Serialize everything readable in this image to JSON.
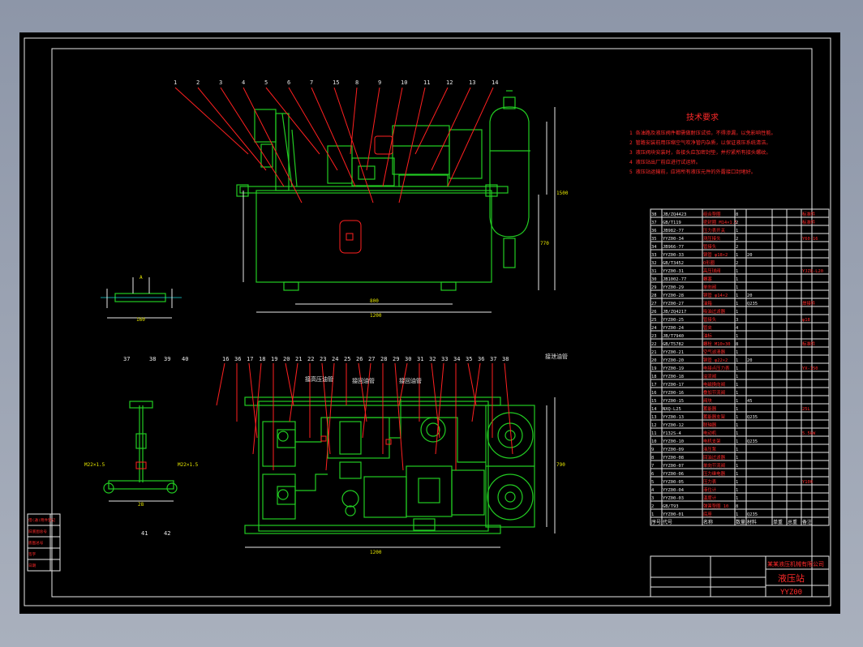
{
  "tech_requirements": {
    "title": "技术要求",
    "items": [
      "1 各油路及液压阀件都需做耐压试验，不得渗漏，以免影响性能。",
      "2 管路安装前用压缩空气吹净管内杂质，以保证液压系统清洁。",
      "3 液压阀块安装时，各接头应加密封垫，并拧紧所有接头螺纹。",
      "4 液压站出厂前应进行试运转。",
      "5 液压站运输前，应将所有液压元件的外露接口封堵好。"
    ]
  },
  "title_block": {
    "company": "某某液压机械有限公司",
    "drawing_name": "液压站",
    "drawing_code": "YYZ00"
  },
  "left_revision_block": {
    "rows": [
      "借(通)用件登记",
      "旧底图总号",
      "底图总号",
      "签字",
      "日期"
    ]
  },
  "top_view_callouts": [
    "1",
    "2",
    "3",
    "4",
    "5",
    "6",
    "7",
    "15",
    "8",
    "9",
    "10",
    "11",
    "12",
    "13",
    "14"
  ],
  "bottom_view_callouts": [
    "16",
    "36",
    "17",
    "18",
    "19",
    "20",
    "21",
    "22",
    "23",
    "24",
    "25",
    "26",
    "27",
    "28",
    "29",
    "30",
    "31",
    "32",
    "33",
    "34",
    "35",
    "36",
    "37",
    "38"
  ],
  "side_detail_callouts": [
    "37",
    "38",
    "39",
    "40",
    "41",
    "42"
  ],
  "dimensions": {
    "top_width": "1200",
    "top_base": "800",
    "top_height": "1500",
    "tank_height": "770",
    "bottom_width": "1200",
    "bottom_depth": "790",
    "detail_width": "160",
    "side_width": "28",
    "fitting_a": "M22×1.5",
    "fitting_b": "M22×1.5"
  },
  "flow_labels": [
    "接高压油管",
    "接回油管",
    "接回油管",
    "接泄油管"
  ],
  "bom_header": [
    "序号",
    "代号",
    "名称",
    "数量",
    "材料",
    "单重",
    "总重",
    "备注"
  ],
  "bom_rows": [
    {
      "no": "38",
      "code": "JB/ZQ4423",
      "name": "组合垫圈",
      "qty": "8",
      "mat": "",
      "note": "标准件"
    },
    {
      "no": "37",
      "code": "GB/T119",
      "name": "密封圈 M14×1.5",
      "qty": "2",
      "mat": "",
      "note": "标准件"
    },
    {
      "no": "36",
      "code": "JB982-77",
      "name": "压力表开关",
      "qty": "1",
      "mat": "",
      "note": ""
    },
    {
      "no": "35",
      "code": "YYZ00-34",
      "name": "测压接头",
      "qty": "2",
      "mat": "",
      "note": "Y60-16"
    },
    {
      "no": "34",
      "code": "JB966-77",
      "name": "管接头",
      "qty": "2",
      "mat": "",
      "note": ""
    },
    {
      "no": "33",
      "code": "YYZ00-33",
      "name": "钢管 φ18×2",
      "qty": "1",
      "mat": "20",
      "note": ""
    },
    {
      "no": "32",
      "code": "GB/T3452",
      "name": "O形圈",
      "qty": "2",
      "mat": "",
      "note": ""
    },
    {
      "no": "31",
      "code": "YYZ00-31",
      "name": "高压球阀",
      "qty": "1",
      "mat": "",
      "note": "YJZQ-L20"
    },
    {
      "no": "30",
      "code": "JB1002-77",
      "name": "螺塞",
      "qty": "1",
      "mat": "",
      "note": ""
    },
    {
      "no": "29",
      "code": "YYZ00-29",
      "name": "单向阀",
      "qty": "1",
      "mat": "",
      "note": ""
    },
    {
      "no": "28",
      "code": "YYZ00-28",
      "name": "钢管 φ14×2",
      "qty": "1",
      "mat": "20",
      "note": ""
    },
    {
      "no": "27",
      "code": "YYZ00-27",
      "name": "油箱",
      "qty": "1",
      "mat": "Q235",
      "note": "焊接件"
    },
    {
      "no": "26",
      "code": "JB/ZQ4217",
      "name": "吸油过滤器",
      "qty": "1",
      "mat": "",
      "note": ""
    },
    {
      "no": "25",
      "code": "YYZ00-25",
      "name": "管接头",
      "qty": "3",
      "mat": "",
      "note": "φ18"
    },
    {
      "no": "24",
      "code": "YYZ00-24",
      "name": "管夹",
      "qty": "4",
      "mat": "",
      "note": ""
    },
    {
      "no": "23",
      "code": "JB/T7940",
      "name": "油标",
      "qty": "1",
      "mat": "",
      "note": ""
    },
    {
      "no": "22",
      "code": "GB/T5782",
      "name": "螺栓 M10×30",
      "qty": "8",
      "mat": "",
      "note": "标准件"
    },
    {
      "no": "21",
      "code": "YYZ00-21",
      "name": "空气滤清器",
      "qty": "1",
      "mat": "",
      "note": ""
    },
    {
      "no": "20",
      "code": "YYZ00-20",
      "name": "钢管 φ22×2",
      "qty": "1",
      "mat": "20",
      "note": ""
    },
    {
      "no": "19",
      "code": "YYZ00-19",
      "name": "电接点压力表",
      "qty": "1",
      "mat": "",
      "note": "YX-150"
    },
    {
      "no": "18",
      "code": "YYZ00-18",
      "name": "溢流阀",
      "qty": "1",
      "mat": "",
      "note": ""
    },
    {
      "no": "17",
      "code": "YYZ00-17",
      "name": "电磁换向阀",
      "qty": "1",
      "mat": "",
      "note": ""
    },
    {
      "no": "16",
      "code": "YYZ00-16",
      "name": "叠加节流阀",
      "qty": "1",
      "mat": "",
      "note": ""
    },
    {
      "no": "15",
      "code": "YYZ00-15",
      "name": "阀块",
      "qty": "1",
      "mat": "45",
      "note": ""
    },
    {
      "no": "14",
      "code": "NXQ-L25",
      "name": "蓄能器",
      "qty": "1",
      "mat": "",
      "note": "25L"
    },
    {
      "no": "13",
      "code": "YYZ00-13",
      "name": "蓄能器支架",
      "qty": "1",
      "mat": "Q235",
      "note": ""
    },
    {
      "no": "12",
      "code": "YYZ00-12",
      "name": "联轴器",
      "qty": "1",
      "mat": "",
      "note": ""
    },
    {
      "no": "11",
      "code": "Y132S-4",
      "name": "电动机",
      "qty": "1",
      "mat": "",
      "note": "5.5kW"
    },
    {
      "no": "10",
      "code": "YYZ00-10",
      "name": "电机支架",
      "qty": "1",
      "mat": "Q235",
      "note": ""
    },
    {
      "no": "9",
      "code": "YYZ00-09",
      "name": "液压泵",
      "qty": "1",
      "mat": "",
      "note": ""
    },
    {
      "no": "8",
      "code": "YYZ00-08",
      "name": "回油过滤器",
      "qty": "1",
      "mat": "",
      "note": ""
    },
    {
      "no": "7",
      "code": "YYZ00-07",
      "name": "单向节流阀",
      "qty": "1",
      "mat": "",
      "note": ""
    },
    {
      "no": "6",
      "code": "YYZ00-06",
      "name": "压力继电器",
      "qty": "1",
      "mat": "",
      "note": ""
    },
    {
      "no": "5",
      "code": "YYZ00-05",
      "name": "压力表",
      "qty": "1",
      "mat": "",
      "note": "Y100"
    },
    {
      "no": "4",
      "code": "YYZ00-04",
      "name": "液位计",
      "qty": "1",
      "mat": "",
      "note": ""
    },
    {
      "no": "3",
      "code": "YYZ00-03",
      "name": "温度计",
      "qty": "1",
      "mat": "",
      "note": ""
    },
    {
      "no": "2",
      "code": "GB/T93",
      "name": "弹簧垫圈 10",
      "qty": "8",
      "mat": "",
      "note": ""
    },
    {
      "no": "1",
      "code": "YYZ00-01",
      "name": "底座",
      "qty": "1",
      "mat": "Q235",
      "note": ""
    }
  ]
}
